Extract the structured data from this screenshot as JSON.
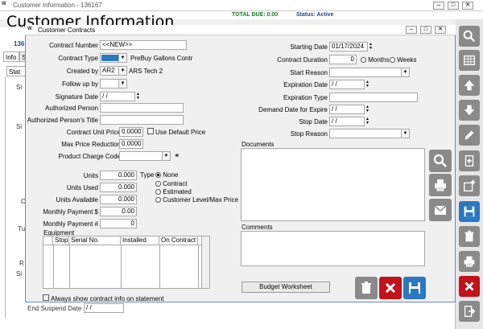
{
  "window": {
    "title": "Customer Information - 136167",
    "heading": "Customer Information",
    "total_due": "TOTAL DUE:  0.00",
    "status": "Status: Active",
    "min": "–",
    "max": "□",
    "close": "✕",
    "logo": "W"
  },
  "left_fragments": {
    "id": "136",
    "tab_info": "Info",
    "tab_s": "S",
    "tab_stat": "Stat",
    "letters": [
      "Si",
      "Si",
      "C",
      "Tu",
      "R",
      "Si"
    ],
    "end_suspend_label": "End Suspend Date",
    "end_suspend_value": "/ /"
  },
  "dialog": {
    "title": "Customer Contracts",
    "contract_number_label": "Contract Number",
    "contract_number_value": "<<NEW>>",
    "contract_type_label": "Contract Type",
    "contract_type_desc": "PreBuy Gallons Contr",
    "created_by_label": "Created by",
    "created_by_value": "AR2",
    "created_by_desc": "ARS Tech 2",
    "follow_up_label": "Follow up by",
    "signature_date_label": "Signature Date",
    "signature_date_value": "/ /",
    "authorized_person_label": "Authorized Person",
    "authorized_title_label": "Authorized Person's Title",
    "unit_price_label": "Contract Unit Price",
    "unit_price_value": "0.0000",
    "use_default_price_label": "Use Default Price",
    "max_price_reduction_label": "Max Price Reduction",
    "max_price_reduction_value": "0.0000",
    "product_charge_code_label": "Product Charge Code",
    "units_label": "Units",
    "units_value": "0.000",
    "units_used_label": "Units Used",
    "units_used_value": "0.000",
    "units_available_label": "Units Available",
    "units_available_value": "0.000",
    "monthly_payment_label": "Monthly Payment $",
    "monthly_payment_value": "0.00",
    "monthly_payment_num_label": "Monthly Payment #",
    "monthly_payment_num_value": "0",
    "type_label": "Type",
    "type_options": [
      "None",
      "Contract",
      "Estimated",
      "Customer Level/Max Price"
    ],
    "type_selected": "None",
    "equipment_label": "Equipment",
    "equipment_columns": [
      "Stop",
      "Serial No.",
      "Installed",
      "On Contract"
    ],
    "always_show_label": "Always show contract info on statement",
    "starting_date_label": "Starting Date",
    "starting_date_value": "01/17/2024",
    "contract_duration_label": "Contract Duration",
    "contract_duration_value": "0",
    "duration_options": [
      "Months",
      "Weeks"
    ],
    "start_reason_label": "Start Reason",
    "expiration_date_label": "Expiration Date",
    "expiration_date_value": "/ /",
    "expiration_type_label": "Expiration Type",
    "demand_date_label": "Demand Date for Expire",
    "demand_date_value": "/ /",
    "stop_date_label": "Stop Date",
    "stop_date_value": "/ /",
    "stop_reason_label": "Stop Reason",
    "documents_label": "Documents",
    "comments_label": "Comments",
    "budget_worksheet_label": "Budget Worksheet"
  },
  "colors": {
    "blue": "#2b78c2",
    "red": "#c0121b",
    "gray": "#8a8a8a",
    "green_text": "#1a7a1a"
  },
  "sidebar_icons": [
    "search-icon",
    "grid-icon",
    "arrow-up-icon",
    "arrow-down-icon",
    "pencil-icon",
    "add-document-icon",
    "add-record-icon",
    "save-icon",
    "trash-icon",
    "print-icon",
    "cancel-icon",
    "exit-icon"
  ]
}
